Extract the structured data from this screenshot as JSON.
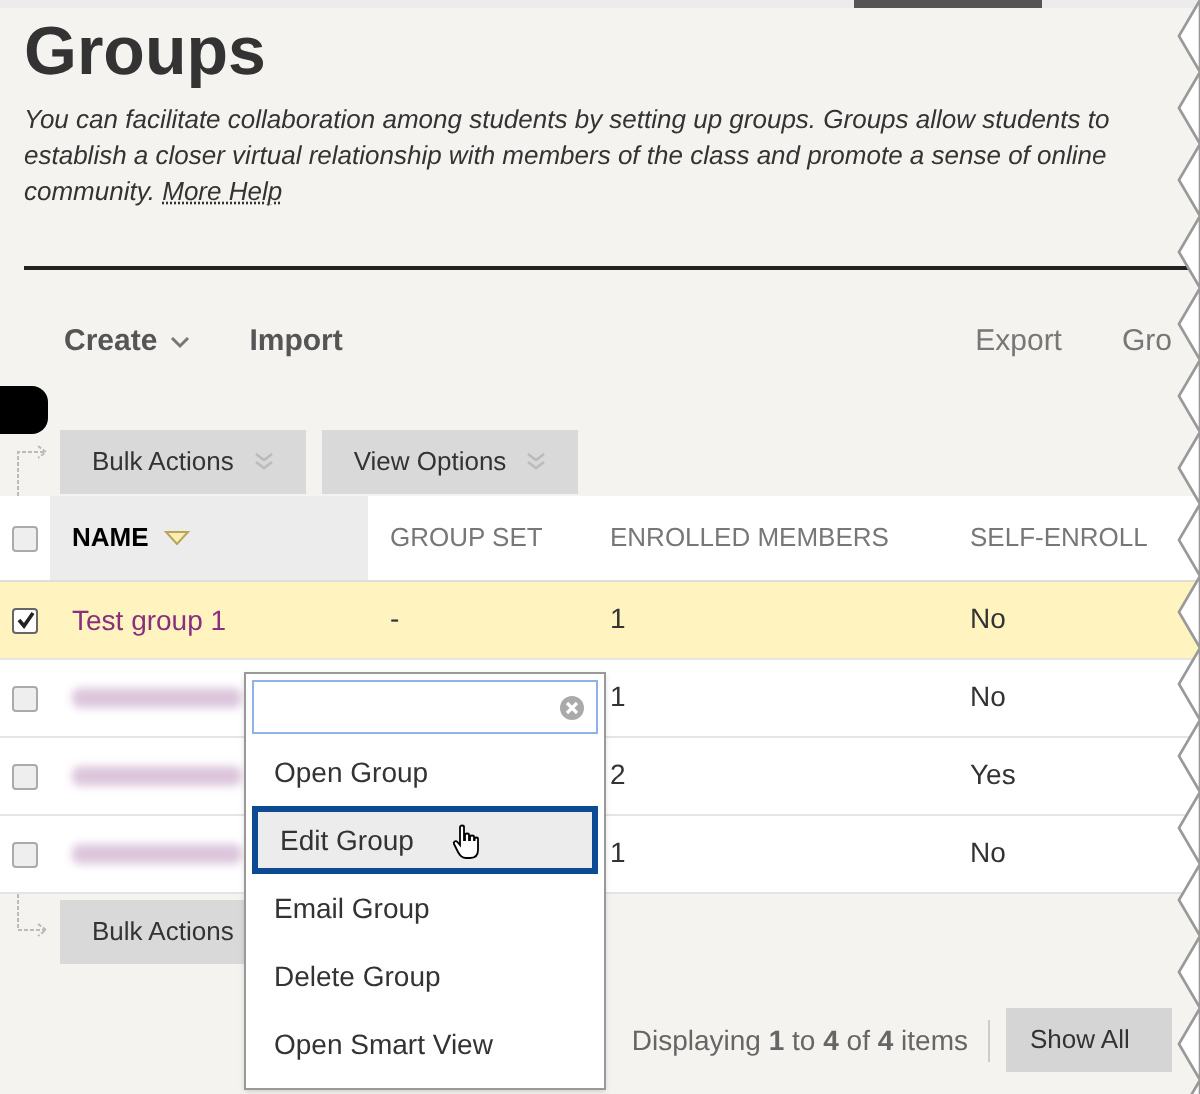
{
  "page": {
    "title": "Groups",
    "description": "You can facilitate collaboration among students by setting up groups. Groups allow students to establish a closer virtual relationship with members of the class and promote a sense of online community.",
    "help_link": "More Help"
  },
  "toolbar": {
    "left": [
      {
        "label": "Create",
        "dropdown": true
      },
      {
        "label": "Import",
        "dropdown": false
      }
    ],
    "right": [
      "Export",
      "Gro"
    ]
  },
  "action_bar_top": [
    {
      "label": "Bulk Actions"
    },
    {
      "label": "View Options"
    }
  ],
  "table": {
    "select_all_checked": false,
    "columns": [
      {
        "label": "NAME",
        "sorted": true
      },
      {
        "label": "GROUP SET",
        "sorted": false
      },
      {
        "label": "ENROLLED MEMBERS",
        "sorted": false
      },
      {
        "label": "SELF-ENROLL",
        "sorted": false
      }
    ],
    "rows": [
      {
        "kind": "link",
        "name": "Test group 1",
        "group_set": "-",
        "enrolled_members": "1",
        "self_enroll": "No",
        "checked": true,
        "selected": true
      },
      {
        "kind": "blurred",
        "enrolled_members": "1",
        "self_enroll": "No",
        "checked": false,
        "selected": false
      },
      {
        "kind": "blurred",
        "enrolled_members": "2",
        "self_enroll": "Yes",
        "checked": false,
        "selected": false
      },
      {
        "kind": "blurred",
        "enrolled_members": "1",
        "self_enroll": "No",
        "checked": false,
        "selected": false
      }
    ]
  },
  "action_bar_bottom": [
    {
      "label": "Bulk Actions"
    }
  ],
  "context_menu": {
    "items": [
      {
        "label": "Open Group",
        "selected": false
      },
      {
        "label": "Edit Group",
        "selected": true
      },
      {
        "label": "Email Group",
        "selected": false
      },
      {
        "label": "Delete Group",
        "selected": false
      },
      {
        "label": "Open Smart View",
        "selected": false
      }
    ]
  },
  "pagination": {
    "summary": "Displaying **1** to **4** of **4** items",
    "button": "Show All"
  }
}
